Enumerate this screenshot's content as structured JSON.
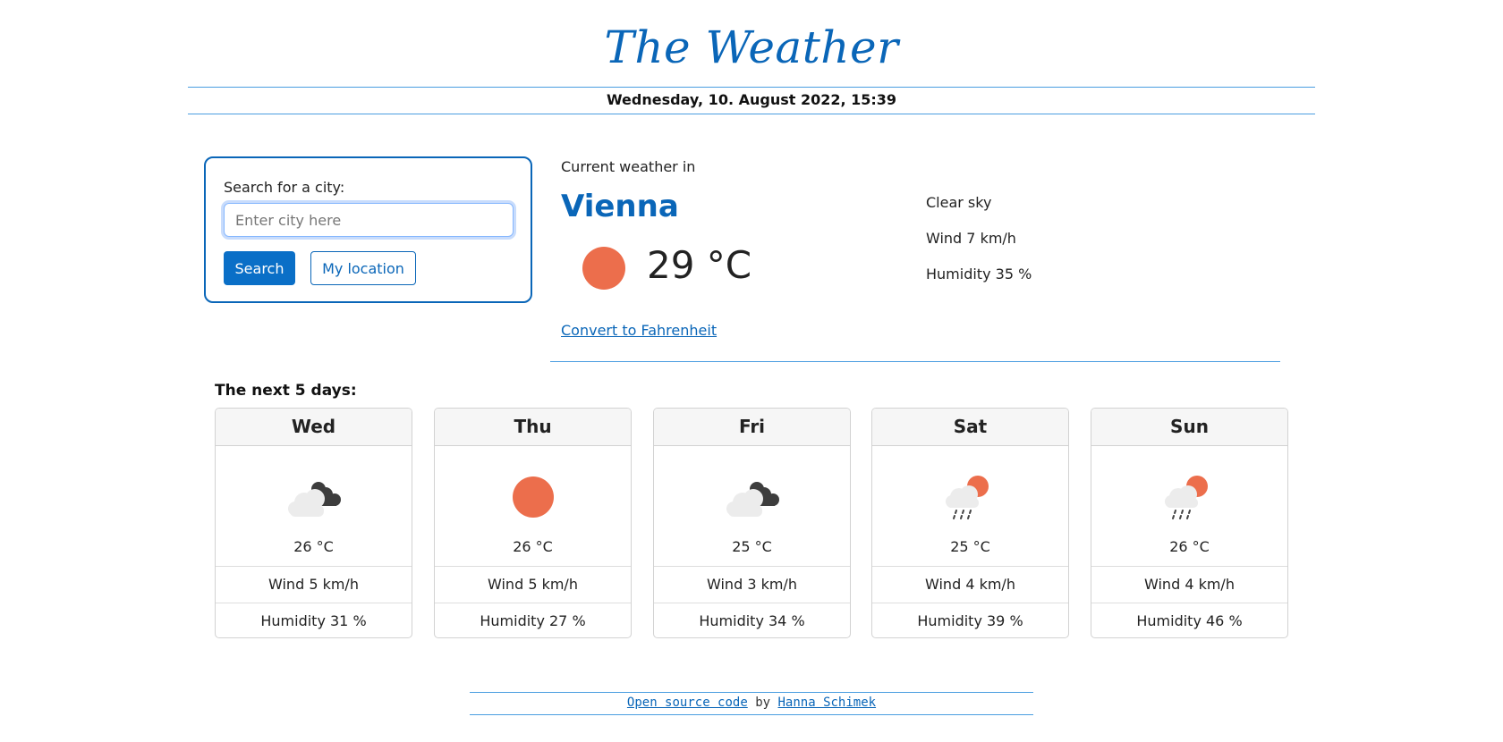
{
  "header": {
    "title": "The Weather",
    "datetime": "Wednesday, 10. August 2022, 15:39"
  },
  "search": {
    "label": "Search for a city:",
    "placeholder": "Enter city here",
    "value": "",
    "search_button": "Search",
    "location_button": "My location"
  },
  "current": {
    "heading": "Current weather in",
    "city": "Vienna",
    "temperature": "29 °C",
    "icon": "sun-icon",
    "convert_link": "Convert to Fahrenheit",
    "description": "Clear sky",
    "wind": "Wind 7 km/h",
    "humidity": "Humidity 35 %"
  },
  "forecast": {
    "heading": "The next 5 days:",
    "days": [
      {
        "name": "Wed",
        "icon": "dark-cloud-icon",
        "temp": "26 °C",
        "wind": "Wind 5 km/h",
        "humidity": "Humidity 31 %"
      },
      {
        "name": "Thu",
        "icon": "sun-icon",
        "temp": "26 °C",
        "wind": "Wind 5 km/h",
        "humidity": "Humidity 27 %"
      },
      {
        "name": "Fri",
        "icon": "dark-cloud-icon",
        "temp": "25 °C",
        "wind": "Wind 3 km/h",
        "humidity": "Humidity 34 %"
      },
      {
        "name": "Sat",
        "icon": "sun-rain-icon",
        "temp": "25 °C",
        "wind": "Wind 4 km/h",
        "humidity": "Humidity 39 %"
      },
      {
        "name": "Sun",
        "icon": "sun-rain-icon",
        "temp": "26 °C",
        "wind": "Wind 4 km/h",
        "humidity": "Humidity 46 %"
      }
    ]
  },
  "footer": {
    "source_link": "Open source code",
    "by": "by",
    "author_link": "Hanna Schimek"
  },
  "colors": {
    "accent": "#0a66b8",
    "sun": "#ec6e4c",
    "divider": "#4a9de0"
  }
}
